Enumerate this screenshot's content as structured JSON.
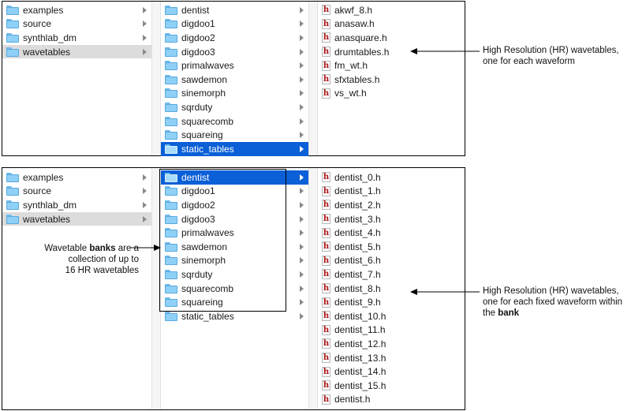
{
  "top_panel": {
    "col1": [
      {
        "label": "examples"
      },
      {
        "label": "source"
      },
      {
        "label": "synthlab_dm"
      },
      {
        "label": "wavetables"
      }
    ],
    "col2": [
      {
        "label": "dentist"
      },
      {
        "label": "digdoo1"
      },
      {
        "label": "digdoo2"
      },
      {
        "label": "digdoo3"
      },
      {
        "label": "primalwaves"
      },
      {
        "label": "sawdemon"
      },
      {
        "label": "sinemorph"
      },
      {
        "label": "sqrduty"
      },
      {
        "label": "squarecomb"
      },
      {
        "label": "squareing"
      },
      {
        "label": "static_tables"
      }
    ],
    "col3": [
      {
        "label": "akwf_8.h"
      },
      {
        "label": "anasaw.h"
      },
      {
        "label": "anasquare.h"
      },
      {
        "label": "drumtables.h"
      },
      {
        "label": "fm_wt.h"
      },
      {
        "label": "sfxtables.h"
      },
      {
        "label": "vs_wt.h"
      }
    ]
  },
  "bottom_panel": {
    "col1": [
      {
        "label": "examples"
      },
      {
        "label": "source"
      },
      {
        "label": "synthlab_dm"
      },
      {
        "label": "wavetables"
      }
    ],
    "col2": [
      {
        "label": "dentist"
      },
      {
        "label": "digdoo1"
      },
      {
        "label": "digdoo2"
      },
      {
        "label": "digdoo3"
      },
      {
        "label": "primalwaves"
      },
      {
        "label": "sawdemon"
      },
      {
        "label": "sinemorph"
      },
      {
        "label": "sqrduty"
      },
      {
        "label": "squarecomb"
      },
      {
        "label": "squareing"
      },
      {
        "label": "static_tables"
      }
    ],
    "col3": [
      {
        "label": "dentist_0.h"
      },
      {
        "label": "dentist_1.h"
      },
      {
        "label": "dentist_2.h"
      },
      {
        "label": "dentist_3.h"
      },
      {
        "label": "dentist_4.h"
      },
      {
        "label": "dentist_5.h"
      },
      {
        "label": "dentist_6.h"
      },
      {
        "label": "dentist_7.h"
      },
      {
        "label": "dentist_8.h"
      },
      {
        "label": "dentist_9.h"
      },
      {
        "label": "dentist_10.h"
      },
      {
        "label": "dentist_11.h"
      },
      {
        "label": "dentist_12.h"
      },
      {
        "label": "dentist_13.h"
      },
      {
        "label": "dentist_14.h"
      },
      {
        "label": "dentist_15.h"
      },
      {
        "label": "dentist.h"
      }
    ]
  },
  "annotations": {
    "top_hr": {
      "line1": "High Resolution (HR) wavetables,",
      "line2": "one for each waveform"
    },
    "banks": {
      "line1_pre": "Wavetable ",
      "line1_bold": "banks",
      "line1_post": " are a",
      "line2": "collection of up to",
      "line3": "16 HR wavetables"
    },
    "bottom_hr": {
      "line1": "High Resolution (HR) wavetables,",
      "line2": "one for each fixed waveform within",
      "line3_pre": "the ",
      "line3_bold": "bank"
    }
  },
  "colors": {
    "selection_blue": "#0b5fd7",
    "selection_grey": "#dcdcdc",
    "header_file_icon": "#b01818",
    "folder_blue": "#8fd0f7"
  },
  "icons": {
    "folder": "folder-icon",
    "header_file": "h-file-icon",
    "disclosure": "chevron-right-icon"
  }
}
